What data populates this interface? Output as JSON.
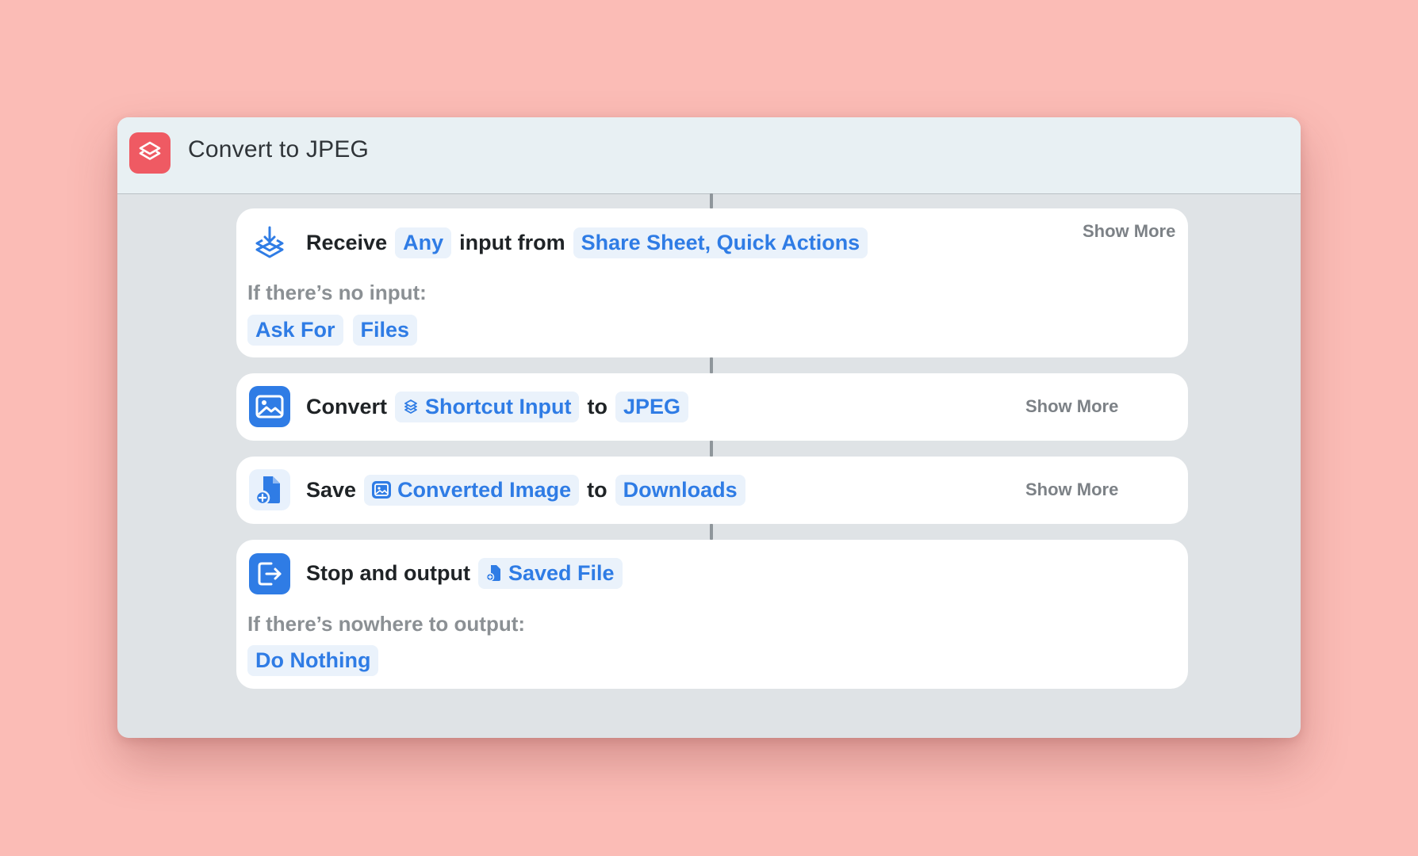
{
  "window": {
    "title": "Convert to JPEG",
    "app_icon": "shortcuts-icon"
  },
  "actions": [
    {
      "icon": "receive-input-icon",
      "verb": "Receive",
      "type_token": "Any",
      "mid_text": "input from",
      "source_token": "Share Sheet, Quick Actions",
      "show_more": "Show More",
      "fallback_label": "If there’s no input:",
      "fallback_tokens": [
        "Ask For",
        "Files"
      ]
    },
    {
      "icon": "image-icon",
      "verb": "Convert",
      "input_token": "Shortcut Input",
      "to_text": "to",
      "format_token": "JPEG",
      "show_more": "Show More"
    },
    {
      "icon": "file-add-icon",
      "verb": "Save",
      "input_token": "Converted Image",
      "to_text": "to",
      "destination_token": "Downloads",
      "show_more": "Show More"
    },
    {
      "icon": "exit-output-icon",
      "verb": "Stop and output",
      "output_token": "Saved File",
      "fallback_label": "If there’s nowhere to output:",
      "fallback_token": "Do Nothing"
    }
  ],
  "colors": {
    "background": "#fbbcb6",
    "accent_blue": "#2f7ce5",
    "app_icon_red": "#ef5a63"
  }
}
